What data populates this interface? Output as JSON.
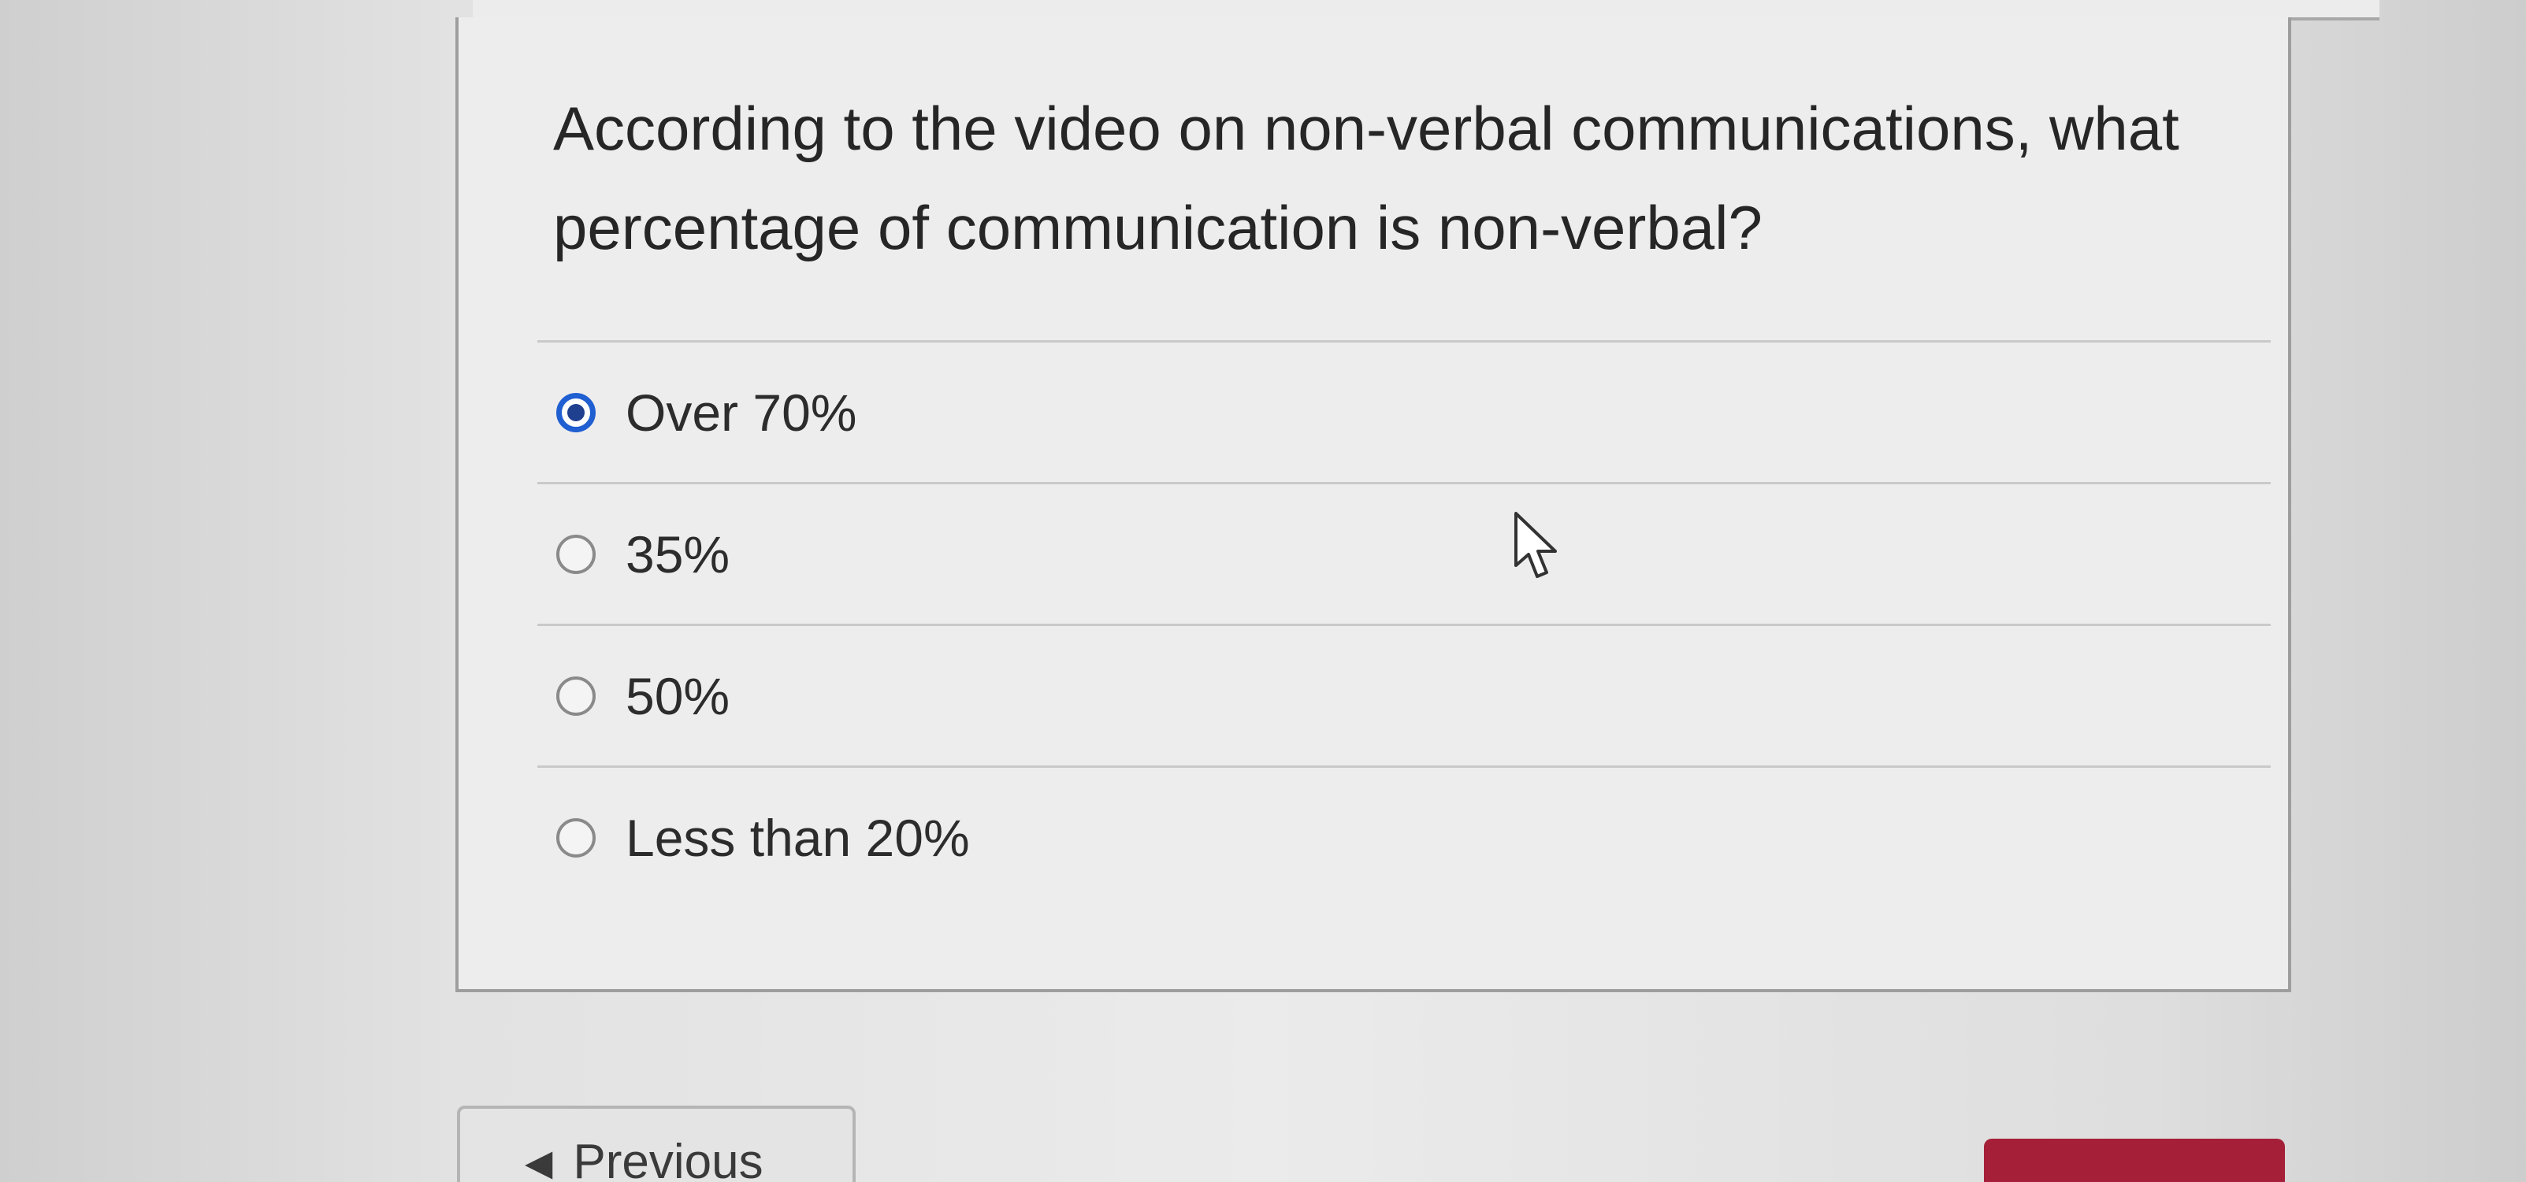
{
  "question": {
    "text": "According to the video on non-verbal communications, what percentage of communication is non-verbal?"
  },
  "answers": [
    {
      "label": "Over 70%",
      "selected": true
    },
    {
      "label": "35%",
      "selected": false
    },
    {
      "label": "50%",
      "selected": false
    },
    {
      "label": "Less than 20%",
      "selected": false
    }
  ],
  "navigation": {
    "previous_label": "Previous",
    "previous_arrow": "◀"
  },
  "icons": {
    "radio_selected": "radio-selected-icon",
    "radio_unselected": "radio-unselected-icon",
    "cursor": "mouse-pointer-icon",
    "previous": "left-arrow-icon"
  },
  "colors": {
    "selected_radio": "#1f5fd1",
    "next_button": "#a51f38"
  }
}
